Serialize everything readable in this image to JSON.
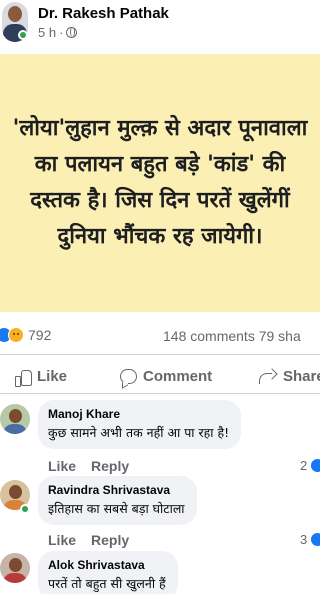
{
  "post": {
    "author": "Dr. Rakesh Pathak",
    "time": "5 h",
    "separator": "·",
    "text": "'लोया'लुहान मुल्क़ से अदार पूनावाला का पलायन बहुत बड़े 'कांड' की दस्तक है। जिस दिन परतें खुलेंगीं दुनिया भौंचक रह जायेगी।",
    "card_color": "#fbefb3"
  },
  "stats": {
    "reaction_count": "792",
    "comments": "148 comments",
    "shares": "79 sha"
  },
  "actions": {
    "like": "Like",
    "comment": "Comment",
    "share": "Share"
  },
  "comments": [
    {
      "name": "Manoj Khare",
      "text": "कुछ सामने अभी तक नहीं आ पा रहा है!",
      "like": "Like",
      "reply": "Reply",
      "reactions": "2"
    },
    {
      "name": "Ravindra Shrivastava",
      "text": "इतिहास का सबसे बड़ा घोटाला",
      "like": "Like",
      "reply": "Reply",
      "reactions": "3"
    },
    {
      "name": "Alok Shrivastava",
      "text": "परतें तो बहुत सी खुलनी हैं"
    }
  ],
  "colors": {
    "accent": "#1877f2",
    "online": "#31a24c",
    "secondary_text": "#65676b"
  }
}
